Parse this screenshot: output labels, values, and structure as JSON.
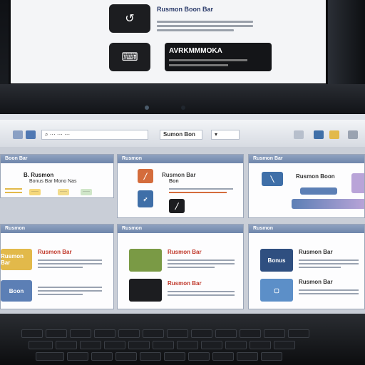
{
  "monitor": {
    "header_title": "Rusmon Boon Bar",
    "tile1_icon": "↺",
    "tile2_icon": "⌨",
    "dark_bar_text": "AVRKMMMOKA"
  },
  "toolbar": {
    "field1": "⌕ ··· ··· ···",
    "field2": "Sumon Bon",
    "field3": "▾"
  },
  "panels": [
    {
      "header": "Boon Bar",
      "title": "B. Rusmon",
      "sub": "Bonus Bar Mono Nas",
      "chips": [
        "·····",
        "·····",
        "·····"
      ]
    },
    {
      "header": "Rusmon",
      "title": "Rusmon Bar",
      "sub": "Bon"
    },
    {
      "header": "Rusmon Bar",
      "title": "Rusmon Boon"
    },
    {
      "header": "Rusmon",
      "title": "Rusmon Bar",
      "tile1": "Rusmon Bar",
      "tile2": "Boon"
    },
    {
      "header": "Rusmon",
      "title1": "Rusmon Bar",
      "title2": "Rusmon Bar"
    },
    {
      "header": "Rusmon",
      "title1": "Rusmon Bar",
      "title2": "Rusmon Bar",
      "tile1": "Bonus"
    }
  ],
  "colors": {
    "accent_blue": "#5c7fb5",
    "yellow": "#e2b94a",
    "green": "#7a9a45",
    "dark": "#1c1d20",
    "orange": "#d46c3c"
  }
}
